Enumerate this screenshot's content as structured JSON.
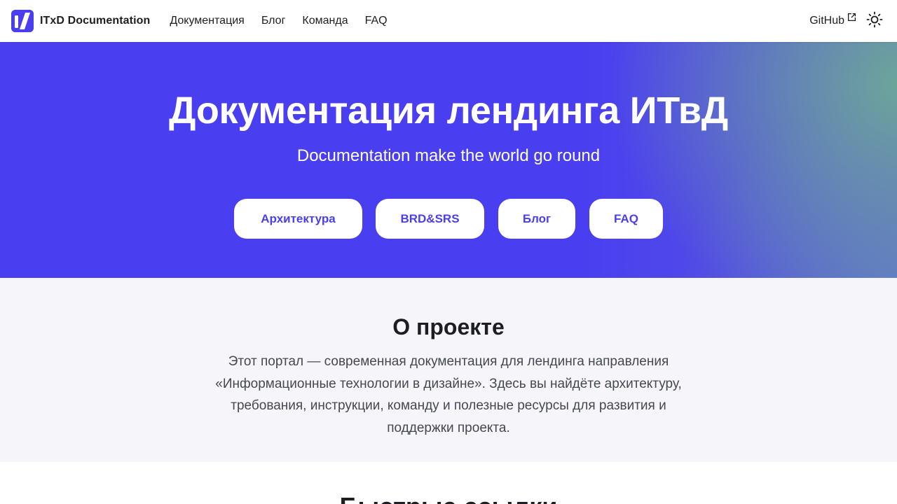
{
  "navbar": {
    "brand_title": "ITxD Documentation",
    "links": [
      {
        "label": "Документация"
      },
      {
        "label": "Блог"
      },
      {
        "label": "Команда"
      },
      {
        "label": "FAQ"
      }
    ],
    "github_label": "GitHub",
    "theme_icon": "sun-icon"
  },
  "hero": {
    "title": "Документация лендинга ИТвД",
    "subtitle": "Documentation make the world go round",
    "buttons": [
      {
        "label": "Архитектура"
      },
      {
        "label": "BRD&SRS"
      },
      {
        "label": "Блог"
      },
      {
        "label": "FAQ"
      }
    ]
  },
  "about": {
    "title": "О проекте",
    "text": "Этот портал — современная документация для лендинга направления «Информационные технологии в дизайне». Здесь вы найдёте архитектуру, требования, инструкции, команду и полезные ресурсы для развития и поддержки проекта."
  },
  "quick_links": {
    "title": "Быстрые ссылки"
  },
  "colors": {
    "accent": "#4a3ff0",
    "hero_corner": "#6eaa96",
    "about_background": "#f5f5fa",
    "text_primary": "#1c1e21",
    "text_secondary": "#444950"
  }
}
